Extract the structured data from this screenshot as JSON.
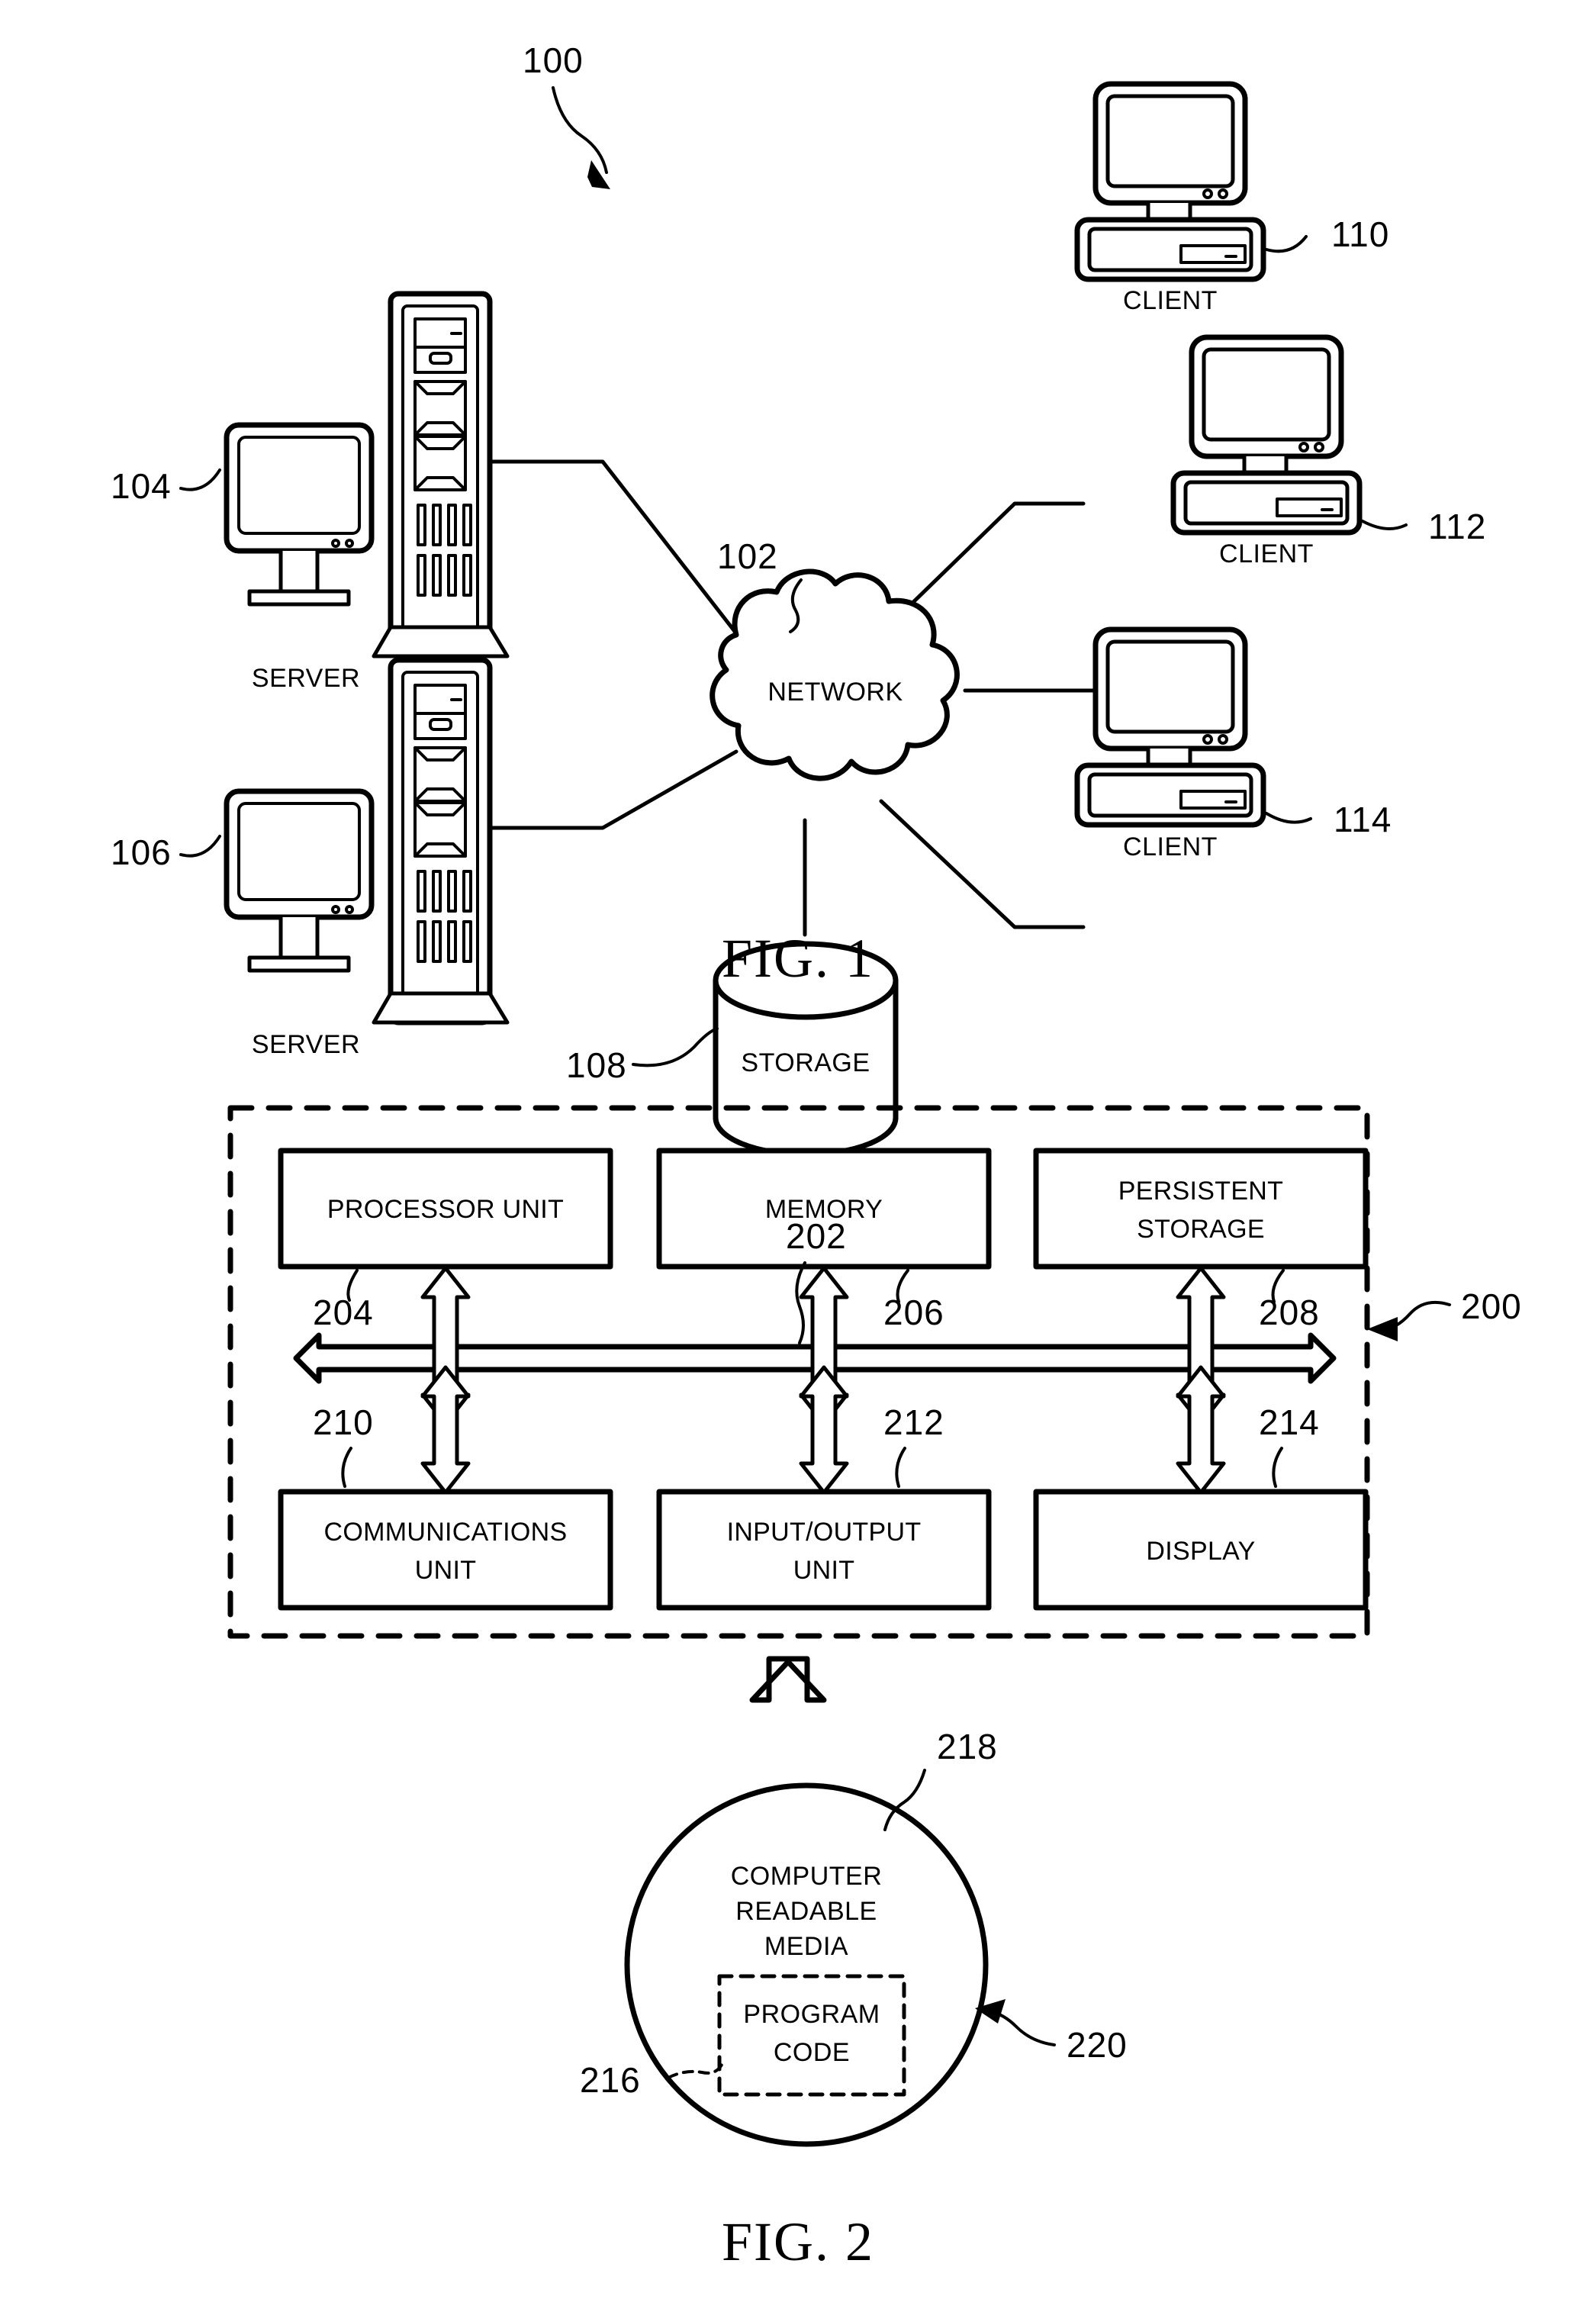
{
  "figure1": {
    "caption": "FIG. 1",
    "system_ref": "100",
    "network": {
      "label": "NETWORK",
      "ref": "102"
    },
    "storage": {
      "label": "STORAGE",
      "ref": "108"
    },
    "servers": [
      {
        "label": "SERVER",
        "ref": "104"
      },
      {
        "label": "SERVER",
        "ref": "106"
      }
    ],
    "clients": [
      {
        "label": "CLIENT",
        "ref": "110"
      },
      {
        "label": "CLIENT",
        "ref": "112"
      },
      {
        "label": "CLIENT",
        "ref": "114"
      }
    ]
  },
  "figure2": {
    "caption": "FIG. 2",
    "data_processing_system_ref": "200",
    "bus_ref": "202",
    "top_blocks": [
      {
        "lines": [
          "PROCESSOR UNIT"
        ],
        "ref": "204"
      },
      {
        "lines": [
          "MEMORY"
        ],
        "ref": "206"
      },
      {
        "lines": [
          "PERSISTENT",
          "STORAGE"
        ],
        "ref": "208"
      }
    ],
    "bottom_blocks": [
      {
        "lines": [
          "COMMUNICATIONS",
          "UNIT"
        ],
        "ref": "210"
      },
      {
        "lines": [
          "INPUT/OUTPUT",
          "UNIT"
        ],
        "ref": "212"
      },
      {
        "lines": [
          "DISPLAY"
        ],
        "ref": "214"
      }
    ],
    "media": {
      "lines": [
        "COMPUTER",
        "READABLE",
        "MEDIA"
      ],
      "ref": "218",
      "program_code": {
        "lines": [
          "PROGRAM",
          "CODE"
        ],
        "ref": "216"
      },
      "product_ref": "220"
    }
  },
  "colors": {
    "ink": "#000000",
    "paper": "#ffffff"
  }
}
